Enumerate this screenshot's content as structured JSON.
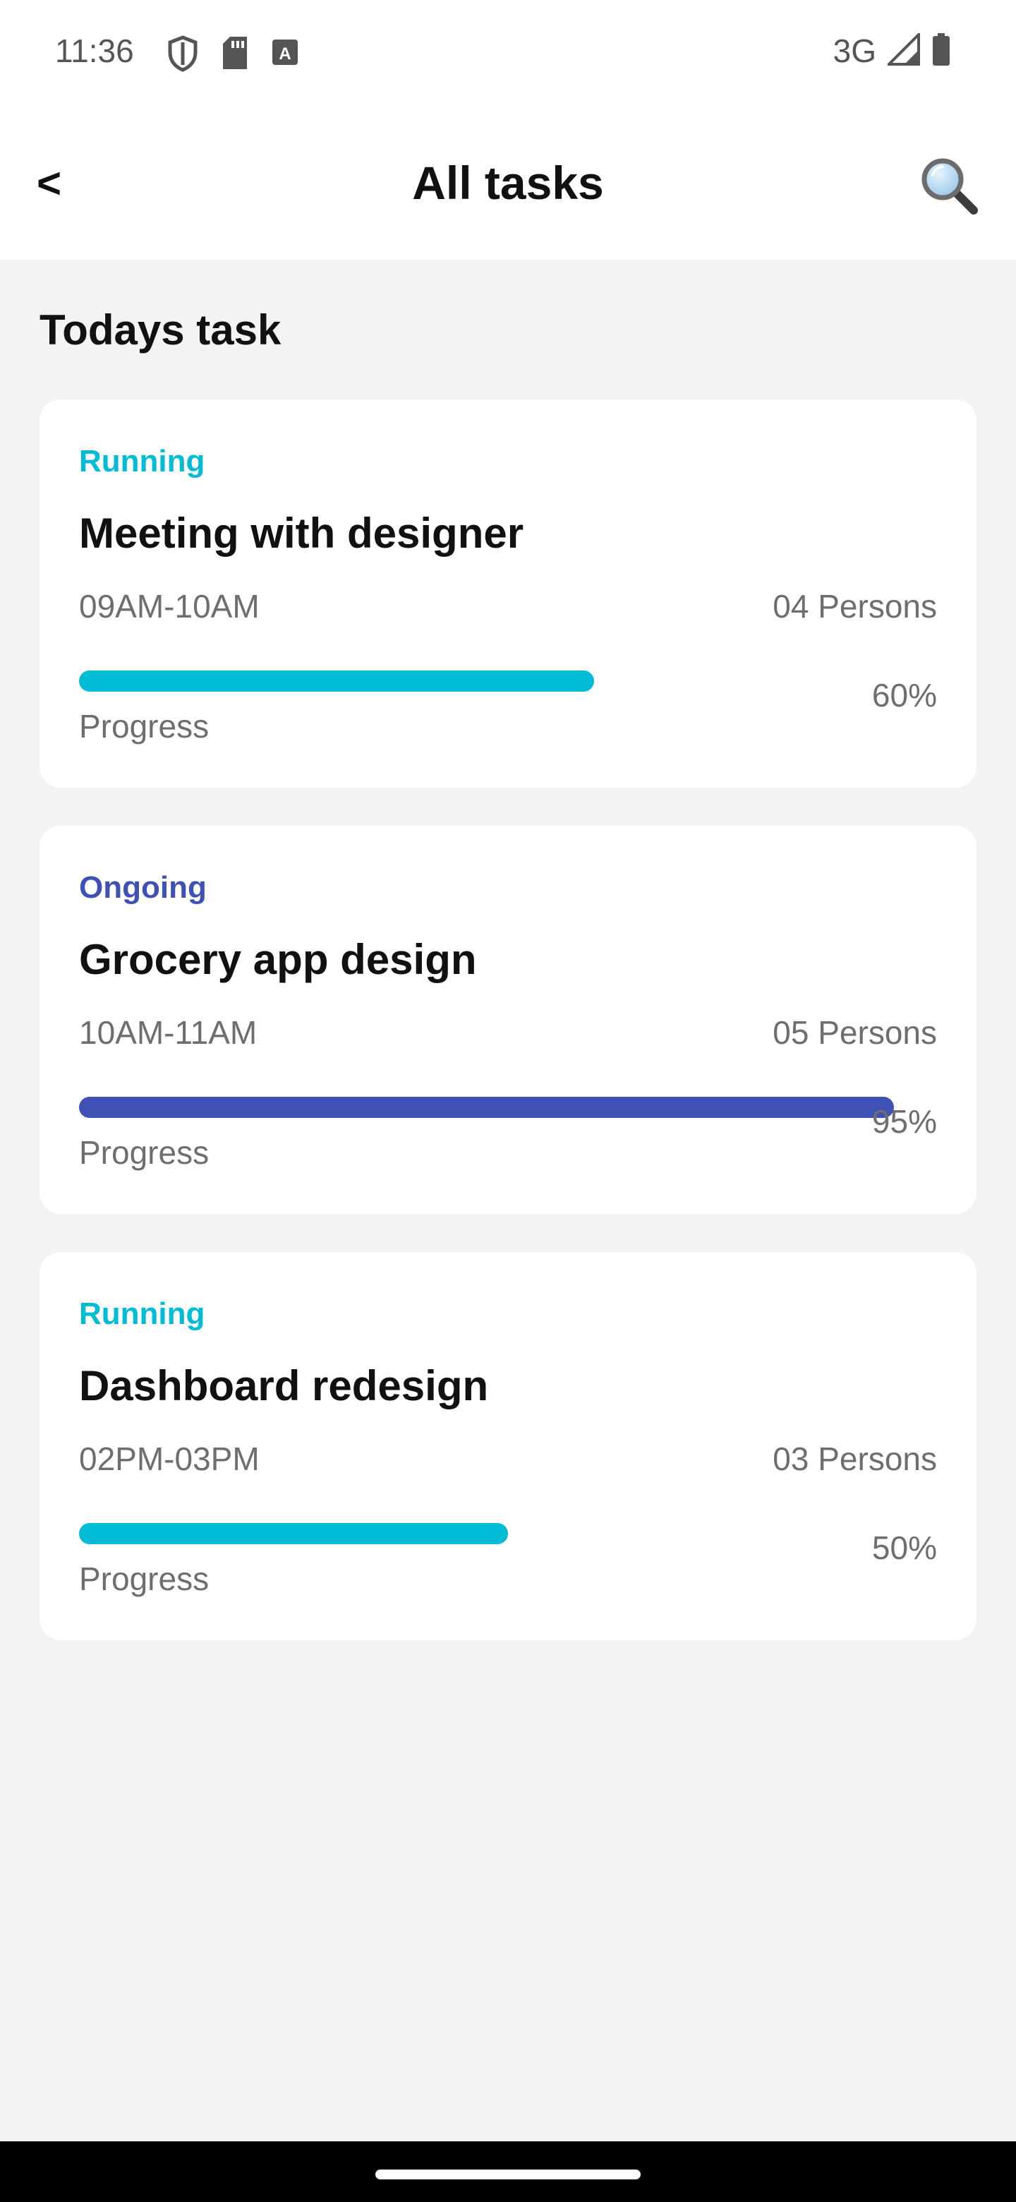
{
  "status_bar": {
    "time": "11:36",
    "network": "3G",
    "icons": [
      "shield-icon",
      "sd-card-icon",
      "keyboard-a-icon",
      "signal-icon",
      "battery-icon"
    ]
  },
  "header": {
    "back_label": "<",
    "title": "All tasks",
    "search_icon": "magnifier-icon"
  },
  "section": {
    "title": "Todays task"
  },
  "colors": {
    "running": "#00BCD4",
    "ongoing": "#3F51B5",
    "background": "#F3F3F3",
    "card": "#FFFFFF"
  },
  "tasks": [
    {
      "status": "Running",
      "status_color": "#00BCD4",
      "title": "Meeting with designer",
      "time": "09AM-10AM",
      "persons": "04 Persons",
      "progress_fraction": 0.6,
      "percent_label": "60%",
      "progress_label": "Progress"
    },
    {
      "status": "Ongoing",
      "status_color": "#3F51B5",
      "title": "Grocery app design",
      "time": "10AM-11AM",
      "persons": "05 Persons",
      "progress_fraction": 0.95,
      "percent_label": "95%",
      "progress_label": "Progress"
    },
    {
      "status": "Running",
      "status_color": "#00BCD4",
      "title": "Dashboard redesign",
      "time": "02PM-03PM",
      "persons": "03 Persons",
      "progress_fraction": 0.5,
      "percent_label": "50%",
      "progress_label": "Progress"
    }
  ]
}
